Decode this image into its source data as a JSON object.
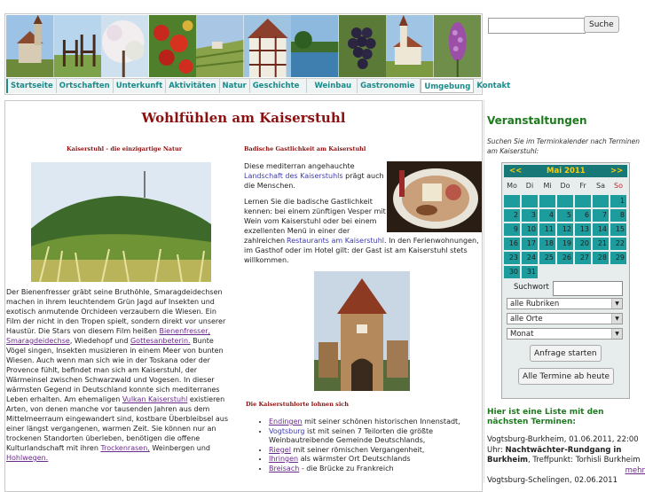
{
  "header": {
    "nav": [
      "Startseite",
      "Ortschaften",
      "Unterkunft",
      "Aktivitäten",
      "Natur",
      "Geschichte",
      "Weinbau",
      "Gastronomie",
      "Umgebung",
      "Kontakt"
    ],
    "active": "Umgebung"
  },
  "search": {
    "button": "Suche",
    "placeholder": ""
  },
  "main": {
    "title": "Wohlfühlen am Kaiserstuhl",
    "left_heading": "Kaiserstuhl - die einzigartige Natur",
    "right_heading": "Badische Gastlichkeit am Kaiserstuhl",
    "right_p1_a": "Diese mediterran angehauchte",
    "right_p1_link": "Landschaft des Kaiserstuhls",
    "right_p1_b": "prägt auch die Menschen.",
    "right_p2_a": "Lernen Sie die badische Gastlichkeit kennen: bei einem zünftigen Vesper mit Wein vom Kaiserstuhl oder bei einem exzellenten Menü in einer der zahlreichen",
    "right_p2_link": "Restaurants am Kaiserstuhl",
    "right_p2_b": ". In den Ferienwohnungen, im Gasthof oder im Hotel gilt: der Gast ist am Kaiserstuhl stets willkommen.",
    "left_p_a": "Der Bienenfresser gräbt seine Bruthöhle, Smaragdeidechsen machen in ihrem leuchtendem Grün Jagd auf Insekten und exotisch anmutende Orchideen verzaubern die Wiesen. Ein Film der nicht in den Tropen spielt, sondern direkt vor unserer Haustür. Die Stars von diesem Film heißen",
    "left_link1": "Bienenfresser,",
    "left_link2": "Smaragdeidechse",
    "left_p_b": ", Wiedehopf und",
    "left_link3": "Gottesanbeterin.",
    "left_p_c": "Bunte Vögel singen, Insekten musizieren in einem Meer von bunten Wiesen. Auch wenn man sich wie in der Toskana oder der Provence fühlt, befindet man sich am Kaiserstuhl, der Wärmeinsel zwischen Schwarzwald und Vogesen. In dieser wärmsten Gegend in Deutschland konnte sich mediterranes Leben erhalten. Am ehemaligen",
    "left_link4": "Vulkan Kaiserstuhl",
    "left_p_d": "existieren Arten, von denen manche vor tausenden Jahren aus dem Mittelmeerraum eingewandert sind, kostbare Überbleibsel aus einer längst vergangenen, warmen Zeit. Sie können nur an trockenen Standorten überleben, benötigen die offene Kulturlandschaft mit ihren",
    "left_link5": "Trockenrasen,",
    "left_p_e": "Weinbergen und",
    "left_link6": "Hohlwegen.",
    "orte_heading": "Die Kaiserstuhlorte lohnen sich",
    "orte": [
      {
        "link": "Endingen",
        "text": " mit seiner schönen historischen Innenstadt,"
      },
      {
        "link": "Vogtsburg",
        "text": " ist mit seinen 7 Teilorten die größte Weinbautreibende Gemeinde Deutschlands,"
      },
      {
        "link": "Riegel",
        "text": " mit seiner römischen Vergangenheit,"
      },
      {
        "link": "Ihringen",
        "text": "  als wärmster Ort Deutschlands"
      },
      {
        "link": "Breisach",
        "text": "  - die Brücke zu Frankreich"
      }
    ]
  },
  "sidebar": {
    "title": "Veranstaltungen",
    "desc_a": "Suchen Sie im Terminkalender nach Terminen am Kaiserstuhl:",
    "calendar": {
      "prev": "<<",
      "month": "Mai 2011",
      "next": ">>",
      "weekdays": [
        "Mo",
        "Di",
        "Mi",
        "Do",
        "Fr",
        "Sa",
        "So"
      ],
      "days": [
        "",
        "",
        "",
        "",
        "",
        "",
        "1",
        "2",
        "3",
        "4",
        "5",
        "6",
        "7",
        "8",
        "9",
        "10",
        "11",
        "12",
        "13",
        "14",
        "15",
        "16",
        "17",
        "18",
        "19",
        "20",
        "21",
        "22",
        "23",
        "24",
        "25",
        "26",
        "27",
        "28",
        "29",
        "30",
        "31"
      ]
    },
    "suchwort_label": "Suchwort",
    "select_rubrik": "alle Rubriken",
    "select_orte": "alle Orte",
    "select_zeit": "Monat",
    "btn_anfrage": "Anfrage starten",
    "btn_alle": "Alle Termine ab heute",
    "list_title": "Hier ist eine Liste mit den nächsten Terminen:",
    "event1_a": "Vogtsburg-Burkheim, 01.06.2011, 22:00 Uhr:",
    "event1_b": "Nachtwächter-Rundgang in Burkheim",
    "event1_c": ", Treffpunkt: Torhisli Burkheim",
    "event1_more": "mehr",
    "event2": "Vogtsburg-Schelingen, 02.06.2011"
  }
}
